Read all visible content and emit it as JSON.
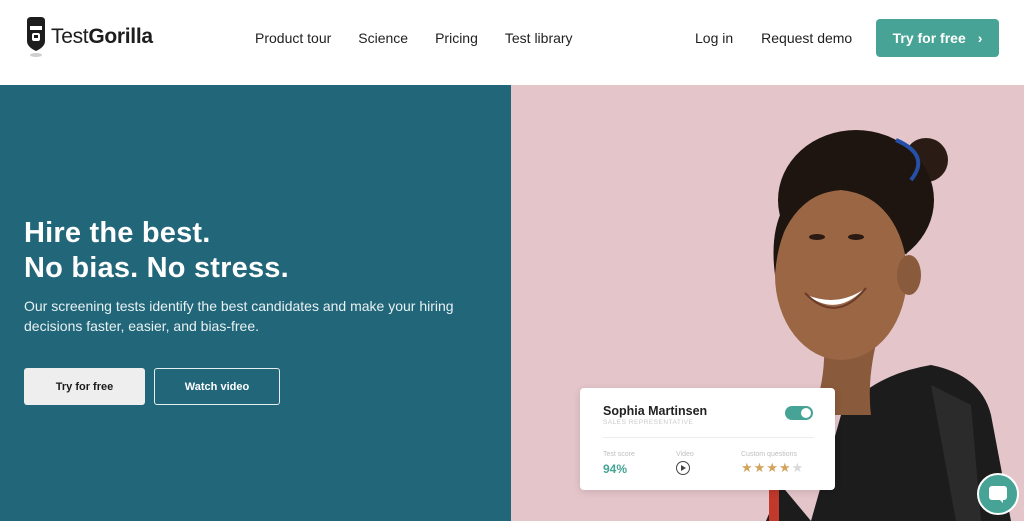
{
  "brand": {
    "name_light": "Test",
    "name_bold": "Gorilla",
    "accent": "#46a395",
    "hero_left_bg": "#226679",
    "hero_right_bg": "#e4c5ca"
  },
  "nav": {
    "items": [
      "Product tour",
      "Science",
      "Pricing",
      "Test library"
    ],
    "login": "Log in",
    "demo": "Request demo",
    "cta": "Try for free"
  },
  "hero": {
    "headline_line1": "Hire the best.",
    "headline_line2": "No bias. No stress.",
    "subtext": "Our screening tests identify the best candidates and make your hiring decisions faster, easier, and bias-free.",
    "primary_button": "Try for free",
    "secondary_button": "Watch video"
  },
  "candidate_card": {
    "name": "Sophia Martinsen",
    "role": "SALES REPRESENTATIVE",
    "toggle_on": true,
    "test_score_label": "Test score",
    "test_score": "94%",
    "video_label": "Video",
    "custom_questions_label": "Custom questions",
    "rating": 4,
    "rating_max": 5
  },
  "icons": {
    "logo": "gorilla-logo-icon",
    "cta_arrow": "chevron-right-icon",
    "play": "play-circle-icon",
    "star": "star-icon",
    "chat": "chat-bubble-icon"
  }
}
